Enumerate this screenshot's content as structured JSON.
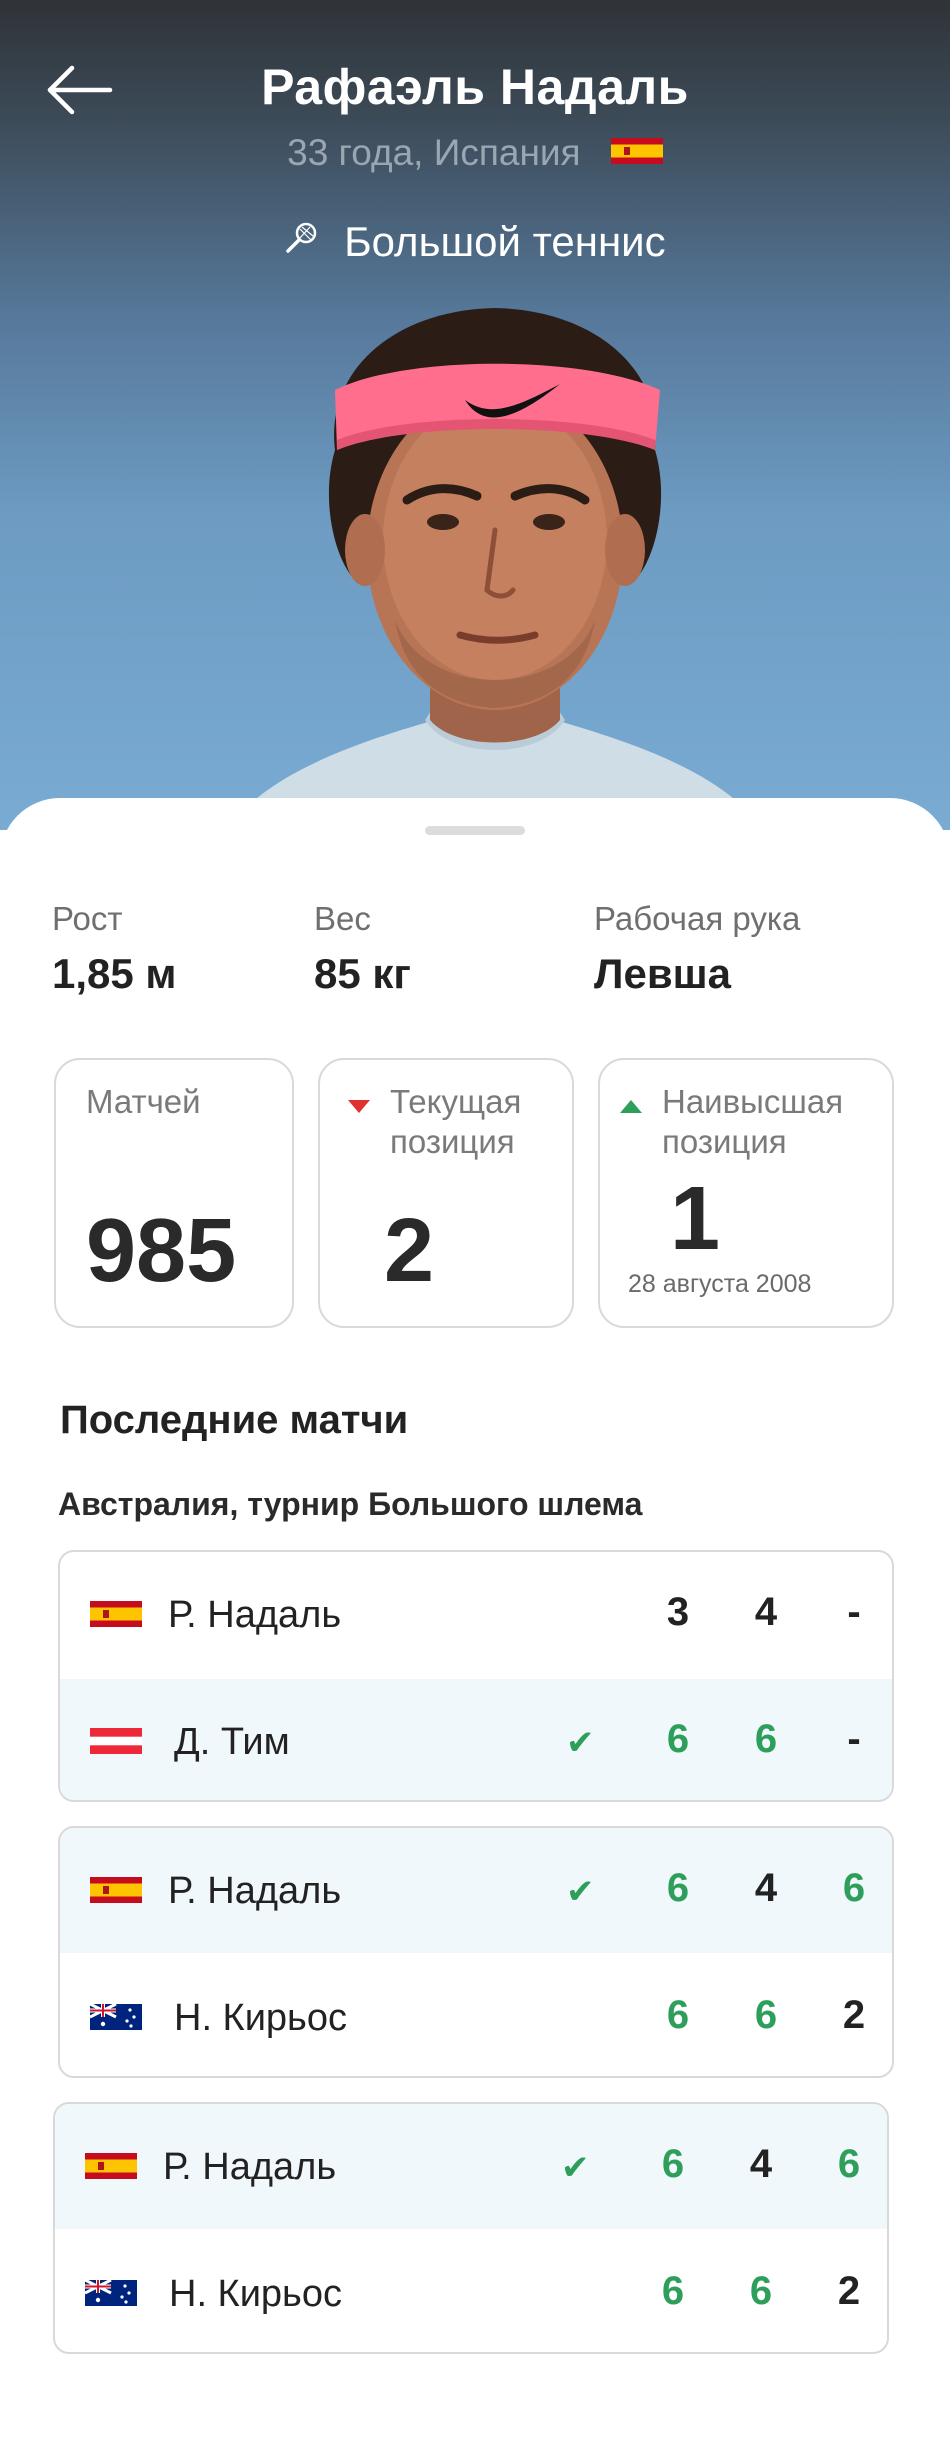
{
  "header": {
    "back_icon": "arrow-left-icon",
    "player_name": "Рафаэль Надаль",
    "subtitle": "33 года, Испания",
    "country_flag": "spain-flag-icon",
    "sport_icon": "tennis-racket-icon",
    "sport": "Большой теннис"
  },
  "attributes": [
    {
      "label": "Рост",
      "value": "1,85 м"
    },
    {
      "label": "Вес",
      "value": "85 кг"
    },
    {
      "label": "Рабочая рука",
      "value": "Левша"
    }
  ],
  "stats": {
    "matches": {
      "label": "Матчей",
      "value": "985"
    },
    "current": {
      "label_line1": "Текущая",
      "label_line2": "позиция",
      "value": "2",
      "trend": "down",
      "trend_color": "#e03131"
    },
    "highest": {
      "label_line1": "Наивысшая",
      "label_line2": "позиция",
      "value": "1",
      "date": "28 августа 2008",
      "trend": "up",
      "trend_color": "#2e9e5b"
    }
  },
  "recent": {
    "title": "Последние матчи",
    "tournament": "Австралия, турнир Большого шлема",
    "matches": [
      {
        "players": [
          {
            "name": "Р. Надаль",
            "flag": "spain",
            "winner": false,
            "scores": [
              "3",
              "4",
              "-"
            ]
          },
          {
            "name": "Д. Тим",
            "flag": "austria",
            "winner": true,
            "scores": [
              "6",
              "6",
              "-"
            ]
          }
        ]
      },
      {
        "players": [
          {
            "name": "Р. Надаль",
            "flag": "spain",
            "winner": true,
            "scores": [
              "6",
              "4",
              "6"
            ]
          },
          {
            "name": "Н. Кирьос",
            "flag": "australia",
            "winner": false,
            "scores": [
              "6",
              "6",
              "2"
            ]
          }
        ]
      },
      {
        "players": [
          {
            "name": "Р. Надаль",
            "flag": "spain",
            "winner": true,
            "scores": [
              "6",
              "4",
              "6"
            ]
          },
          {
            "name": "Н. Кирьос",
            "flag": "australia",
            "winner": false,
            "scores": [
              "6",
              "6",
              "2"
            ]
          }
        ]
      }
    ]
  },
  "colors": {
    "win_green": "#2e9e5b",
    "winner_row_bg": "#f1f8fc",
    "hero_top": "#2f3337",
    "hero_bottom": "#79abd3"
  }
}
